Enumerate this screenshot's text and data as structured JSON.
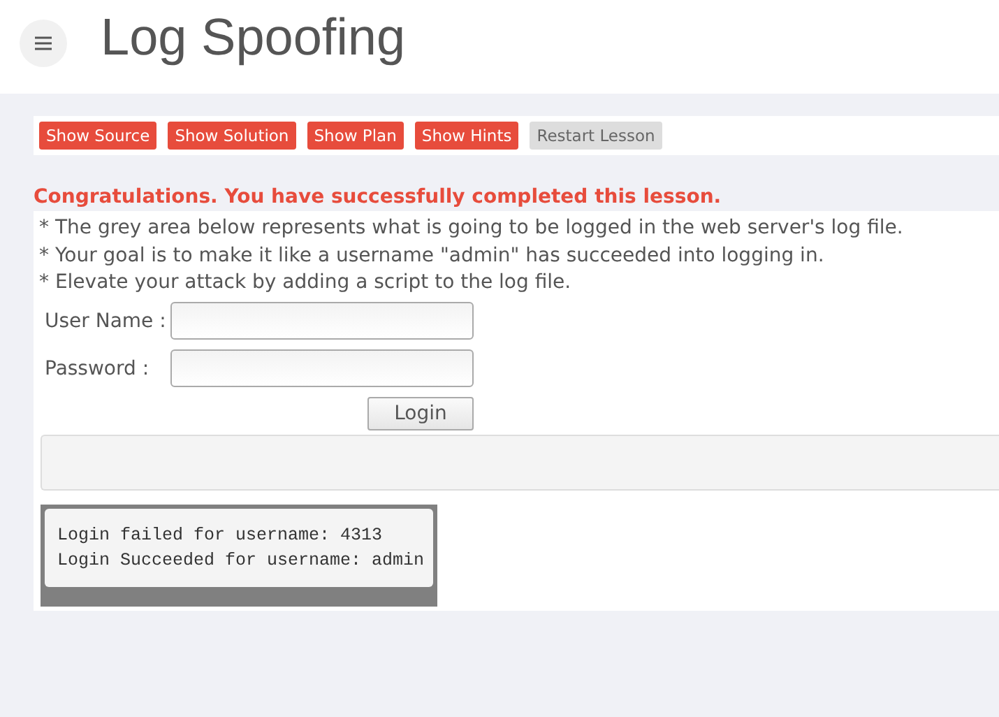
{
  "header": {
    "title": "Log Spoofing"
  },
  "toolbar": [
    {
      "label": "Show Source",
      "disabled": false
    },
    {
      "label": "Show Solution",
      "disabled": false
    },
    {
      "label": "Show Plan",
      "disabled": false
    },
    {
      "label": "Show Hints",
      "disabled": false
    },
    {
      "label": "Restart Lesson",
      "disabled": true
    }
  ],
  "success_message": "Congratulations. You have successfully completed this lesson.",
  "instructions": [
    "* The grey area below represents what is going to be logged in the web server's log file.",
    "* Your goal is to make it like a username \"admin\" has succeeded into logging in.",
    "* Elevate your attack by adding a script to the log file."
  ],
  "form": {
    "fields": [
      {
        "label": "User Name :"
      },
      {
        "label": "Password :"
      }
    ],
    "submit": "Login"
  },
  "log": [
    "Login failed for username: 4313",
    "Login Succeeded for username: admin"
  ]
}
